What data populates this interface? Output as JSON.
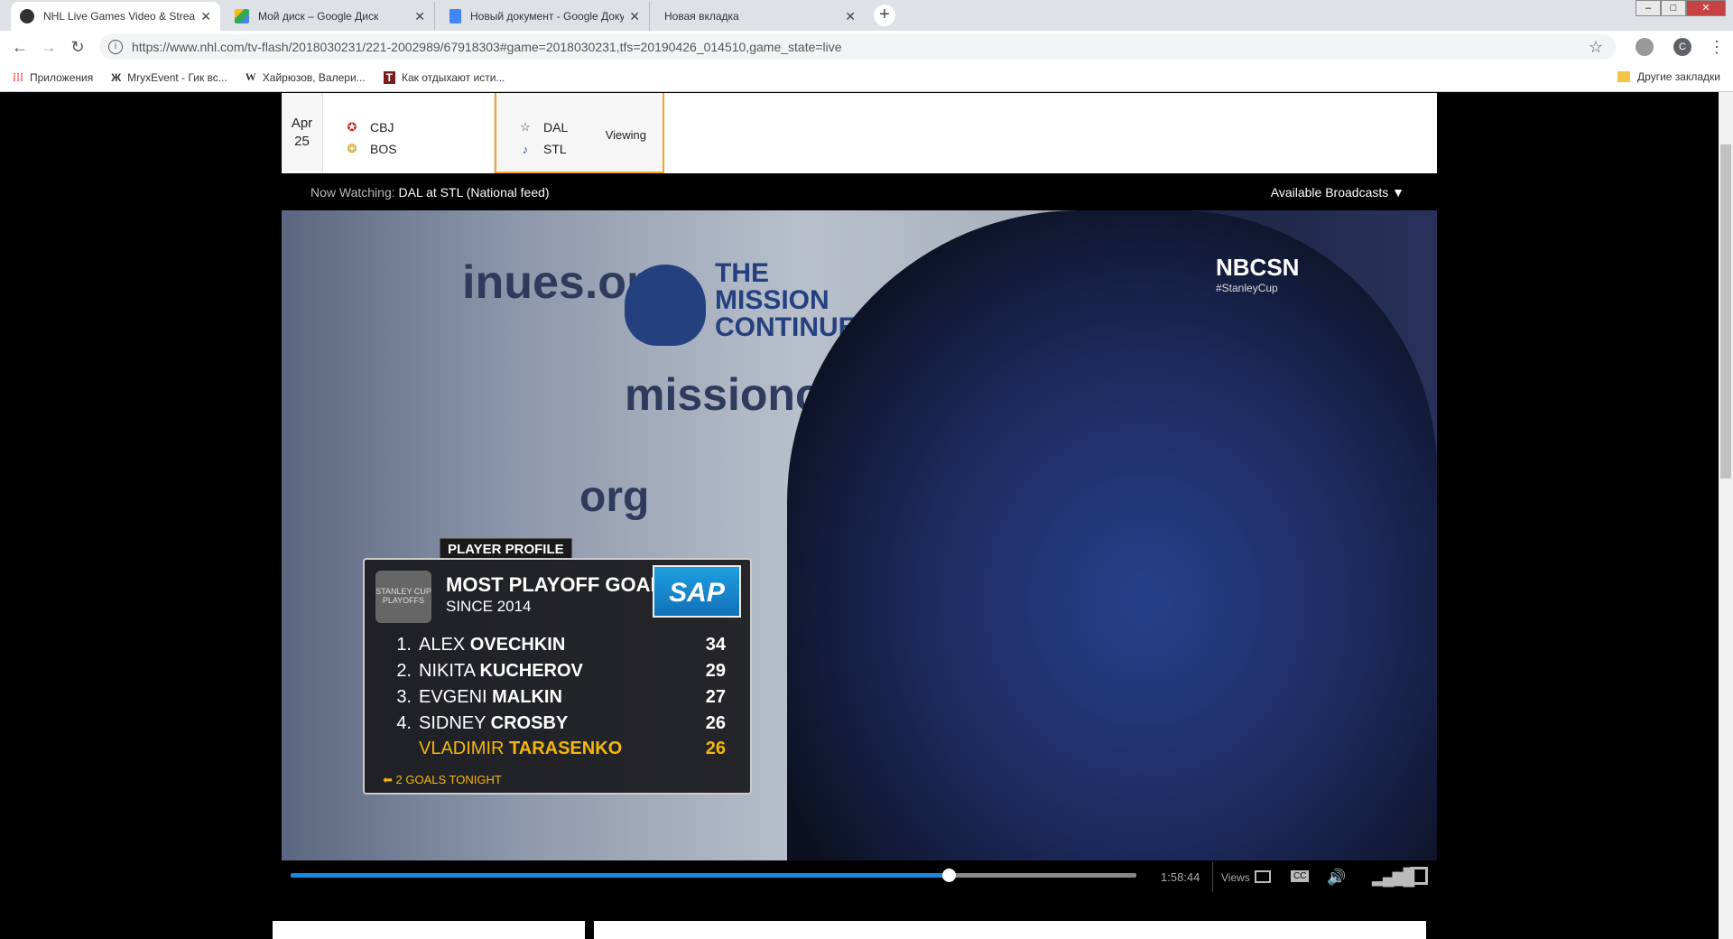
{
  "browser": {
    "tabs": [
      {
        "label": "NHL Live Games Video & Stream",
        "icon": "nhl-icon",
        "active": true
      },
      {
        "label": "Мой диск – Google Диск",
        "icon": "google-drive-icon"
      },
      {
        "label": "Новый документ - Google Доку",
        "icon": "google-docs-icon"
      },
      {
        "label": "Новая вкладка",
        "icon": ""
      }
    ],
    "new_tab": "+",
    "url": "https://www.nhl.com/tv-flash/2018030231/221-2002989/67918303#game=2018030231,tfs=20190426_014510,game_state=live",
    "profile_initial": "C",
    "bookmarks": [
      {
        "label": "Приложения",
        "icon": "apps-icon"
      },
      {
        "label": "MryxEvent - Гик вс...",
        "icon": "mryx-icon"
      },
      {
        "label": "Хайрюзов, Валери...",
        "icon": "wikipedia-icon"
      },
      {
        "label": "Как отдыхают исти...",
        "icon": "bookmark-site-icon"
      }
    ],
    "other_bookmarks": "Другие закладки"
  },
  "scoreboard": {
    "date_month": "Apr",
    "date_day": "25",
    "games": [
      {
        "away": "CBJ",
        "home": "BOS",
        "status": ""
      },
      {
        "away": "DAL",
        "home": "STL",
        "status": "Viewing"
      }
    ]
  },
  "now_watching": {
    "label": "Now Watching:",
    "value": "DAL at STL (National feed)",
    "broadcasts": "Available Broadcasts"
  },
  "video": {
    "wall_text_1": "inues.org",
    "wall_text_2": "missioncontinu",
    "wall_text_3": "org",
    "wall_text_4": "THE MISSION CONTINUES",
    "network": "NBCSN",
    "hashtag": "#StanleyCup",
    "overlay": {
      "tag": "PLAYER PROFILE",
      "title": "MOST PLAYOFF GOALS",
      "subtitle": "SINCE 2014",
      "cup_text": "STANLEY CUP PLAYOFFS",
      "sponsor": "SAP",
      "rows": [
        {
          "rank": "1.",
          "first": "ALEX",
          "last": "OVECHKIN",
          "goals": "34"
        },
        {
          "rank": "2.",
          "first": "NIKITA",
          "last": "KUCHEROV",
          "goals": "29"
        },
        {
          "rank": "3.",
          "first": "EVGENI",
          "last": "MALKIN",
          "goals": "27"
        },
        {
          "rank": "4.",
          "first": "SIDNEY",
          "last": "CROSBY",
          "goals": "26"
        },
        {
          "rank": "",
          "first": "VLADIMIR",
          "last": "TARASENKO",
          "goals": "26"
        }
      ],
      "note": "⬅ 2 GOALS TONIGHT"
    }
  },
  "player": {
    "progress": 0.778,
    "time": "1:58:44",
    "views_label": "Views",
    "cc": "CC"
  },
  "colors": {
    "accent": "#f5a623",
    "progress": "#1b87e0",
    "highlight": "#f5b70a"
  }
}
